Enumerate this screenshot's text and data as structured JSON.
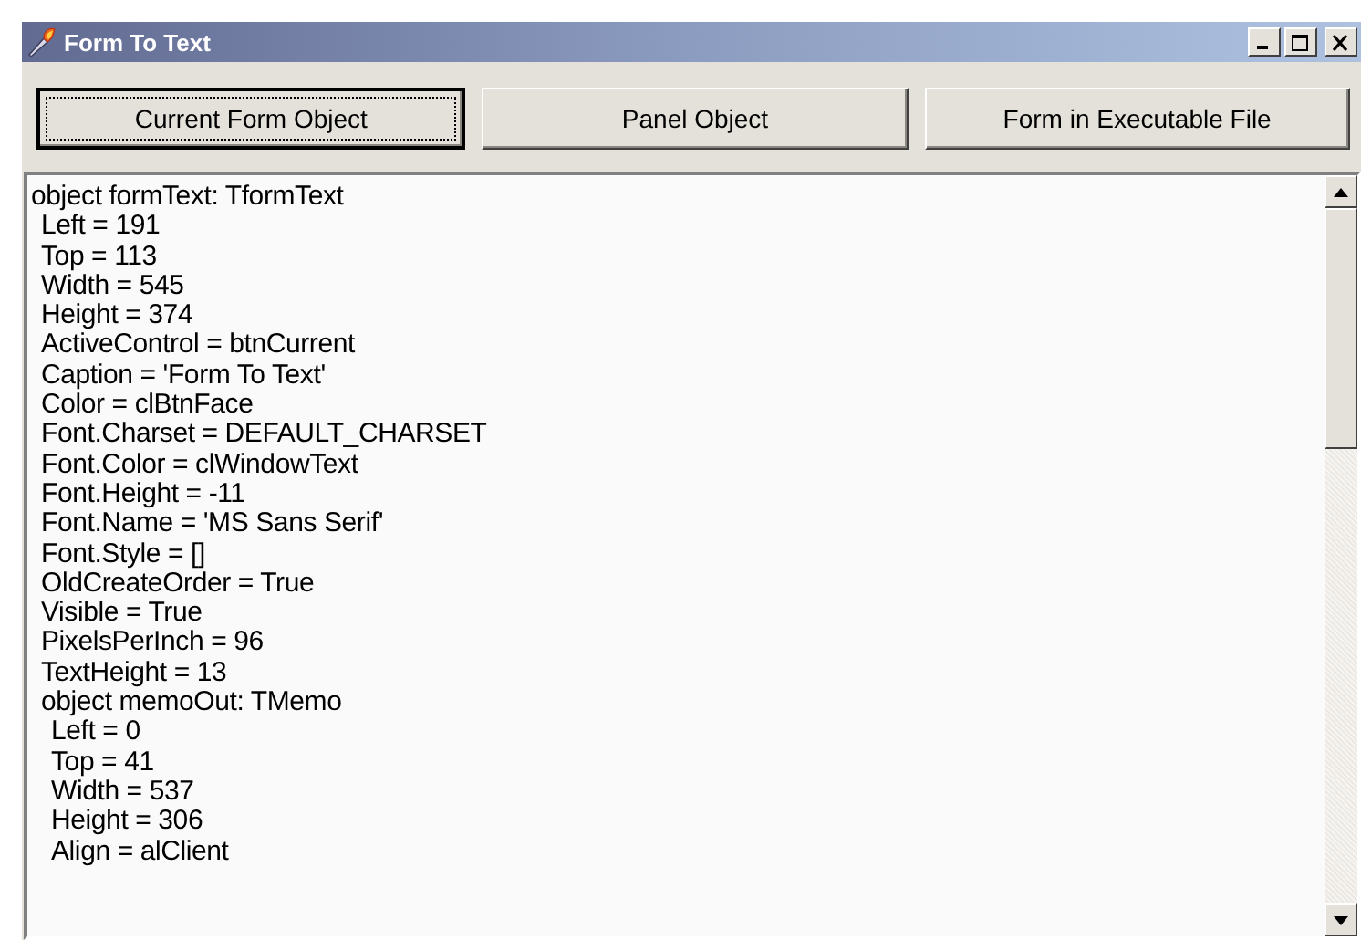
{
  "window": {
    "title": "Form To Text"
  },
  "buttons": [
    {
      "label": "Current Form Object",
      "focused": true
    },
    {
      "label": "Panel Object",
      "focused": false
    },
    {
      "label": "Form in Executable File",
      "focused": false
    }
  ],
  "memo": {
    "lines": [
      {
        "text": "object formText: TformText",
        "children": [
          {
            "text": "Left = 191"
          },
          {
            "text": "Top = 113"
          },
          {
            "text": "Width = 545"
          },
          {
            "text": "Height = 374"
          },
          {
            "text": "ActiveControl = btnCurrent"
          },
          {
            "text": "Caption = 'Form To Text'"
          },
          {
            "text": "Color = clBtnFace"
          },
          {
            "text": "Font.Charset = DEFAULT_CHARSET"
          },
          {
            "text": "Font.Color = clWindowText"
          },
          {
            "text": "Font.Height = -11"
          },
          {
            "text": "Font.Name = 'MS Sans Serif'"
          },
          {
            "text": "Font.Style = []"
          },
          {
            "text": "OldCreateOrder = True"
          },
          {
            "text": "Visible = True"
          },
          {
            "text": "PixelsPerInch = 96"
          },
          {
            "text": "TextHeight = 13"
          },
          {
            "text": "object memoOut: TMemo",
            "children": [
              {
                "text": "Left = 0"
              },
              {
                "text": "Top = 41"
              },
              {
                "text": "Width = 537"
              },
              {
                "text": "Height = 306"
              },
              {
                "text": "Align = alClient"
              }
            ]
          }
        ]
      }
    ]
  }
}
